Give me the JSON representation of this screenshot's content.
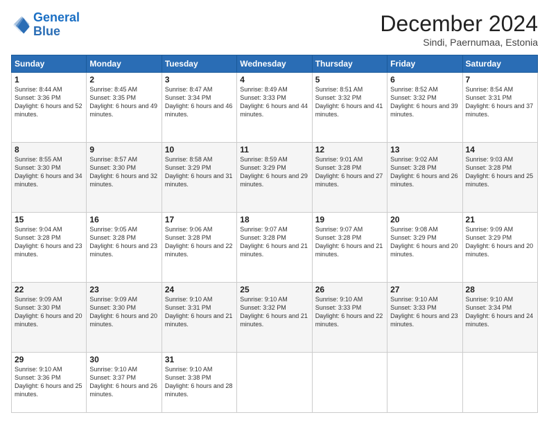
{
  "logo": {
    "line1": "General",
    "line2": "Blue"
  },
  "header": {
    "month": "December 2024",
    "location": "Sindi, Paernumaa, Estonia"
  },
  "days_of_week": [
    "Sunday",
    "Monday",
    "Tuesday",
    "Wednesday",
    "Thursday",
    "Friday",
    "Saturday"
  ],
  "weeks": [
    [
      {
        "day": "1",
        "rise": "8:44 AM",
        "set": "3:36 PM",
        "daylight": "6 hours and 52 minutes."
      },
      {
        "day": "2",
        "rise": "8:45 AM",
        "set": "3:35 PM",
        "daylight": "6 hours and 49 minutes."
      },
      {
        "day": "3",
        "rise": "8:47 AM",
        "set": "3:34 PM",
        "daylight": "6 hours and 46 minutes."
      },
      {
        "day": "4",
        "rise": "8:49 AM",
        "set": "3:33 PM",
        "daylight": "6 hours and 44 minutes."
      },
      {
        "day": "5",
        "rise": "8:51 AM",
        "set": "3:32 PM",
        "daylight": "6 hours and 41 minutes."
      },
      {
        "day": "6",
        "rise": "8:52 AM",
        "set": "3:32 PM",
        "daylight": "6 hours and 39 minutes."
      },
      {
        "day": "7",
        "rise": "8:54 AM",
        "set": "3:31 PM",
        "daylight": "6 hours and 37 minutes."
      }
    ],
    [
      {
        "day": "8",
        "rise": "8:55 AM",
        "set": "3:30 PM",
        "daylight": "6 hours and 34 minutes."
      },
      {
        "day": "9",
        "rise": "8:57 AM",
        "set": "3:30 PM",
        "daylight": "6 hours and 32 minutes."
      },
      {
        "day": "10",
        "rise": "8:58 AM",
        "set": "3:29 PM",
        "daylight": "6 hours and 31 minutes."
      },
      {
        "day": "11",
        "rise": "8:59 AM",
        "set": "3:29 PM",
        "daylight": "6 hours and 29 minutes."
      },
      {
        "day": "12",
        "rise": "9:01 AM",
        "set": "3:28 PM",
        "daylight": "6 hours and 27 minutes."
      },
      {
        "day": "13",
        "rise": "9:02 AM",
        "set": "3:28 PM",
        "daylight": "6 hours and 26 minutes."
      },
      {
        "day": "14",
        "rise": "9:03 AM",
        "set": "3:28 PM",
        "daylight": "6 hours and 25 minutes."
      }
    ],
    [
      {
        "day": "15",
        "rise": "9:04 AM",
        "set": "3:28 PM",
        "daylight": "6 hours and 23 minutes."
      },
      {
        "day": "16",
        "rise": "9:05 AM",
        "set": "3:28 PM",
        "daylight": "6 hours and 23 minutes."
      },
      {
        "day": "17",
        "rise": "9:06 AM",
        "set": "3:28 PM",
        "daylight": "6 hours and 22 minutes."
      },
      {
        "day": "18",
        "rise": "9:07 AM",
        "set": "3:28 PM",
        "daylight": "6 hours and 21 minutes."
      },
      {
        "day": "19",
        "rise": "9:07 AM",
        "set": "3:28 PM",
        "daylight": "6 hours and 21 minutes."
      },
      {
        "day": "20",
        "rise": "9:08 AM",
        "set": "3:29 PM",
        "daylight": "6 hours and 20 minutes."
      },
      {
        "day": "21",
        "rise": "9:09 AM",
        "set": "3:29 PM",
        "daylight": "6 hours and 20 minutes."
      }
    ],
    [
      {
        "day": "22",
        "rise": "9:09 AM",
        "set": "3:30 PM",
        "daylight": "6 hours and 20 minutes."
      },
      {
        "day": "23",
        "rise": "9:09 AM",
        "set": "3:30 PM",
        "daylight": "6 hours and 20 minutes."
      },
      {
        "day": "24",
        "rise": "9:10 AM",
        "set": "3:31 PM",
        "daylight": "6 hours and 21 minutes."
      },
      {
        "day": "25",
        "rise": "9:10 AM",
        "set": "3:32 PM",
        "daylight": "6 hours and 21 minutes."
      },
      {
        "day": "26",
        "rise": "9:10 AM",
        "set": "3:33 PM",
        "daylight": "6 hours and 22 minutes."
      },
      {
        "day": "27",
        "rise": "9:10 AM",
        "set": "3:33 PM",
        "daylight": "6 hours and 23 minutes."
      },
      {
        "day": "28",
        "rise": "9:10 AM",
        "set": "3:34 PM",
        "daylight": "6 hours and 24 minutes."
      }
    ],
    [
      {
        "day": "29",
        "rise": "9:10 AM",
        "set": "3:36 PM",
        "daylight": "6 hours and 25 minutes."
      },
      {
        "day": "30",
        "rise": "9:10 AM",
        "set": "3:37 PM",
        "daylight": "6 hours and 26 minutes."
      },
      {
        "day": "31",
        "rise": "9:10 AM",
        "set": "3:38 PM",
        "daylight": "6 hours and 28 minutes."
      },
      null,
      null,
      null,
      null
    ]
  ]
}
